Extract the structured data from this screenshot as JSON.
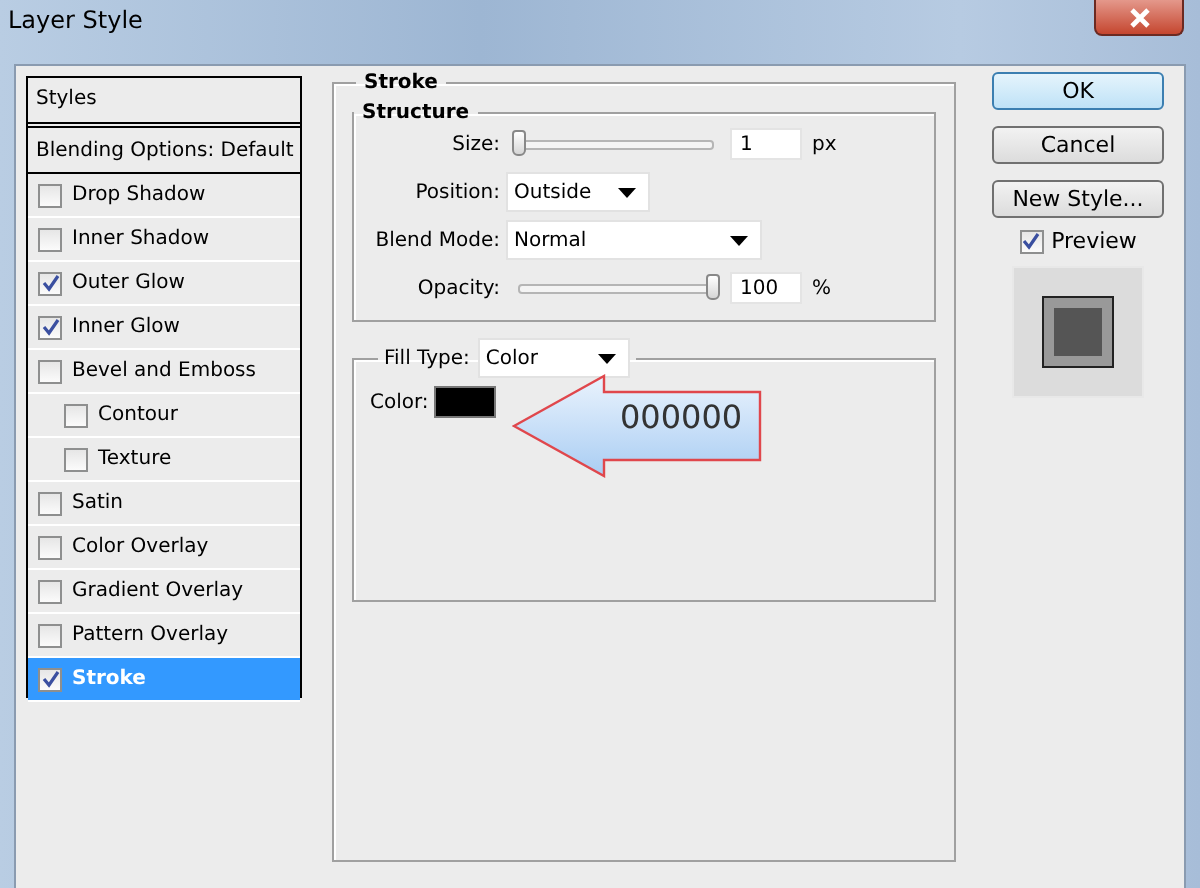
{
  "window": {
    "title": "Layer Style"
  },
  "styles_panel": {
    "header": "Styles",
    "blending_options": "Blending Options: Default",
    "items": [
      {
        "label": "Drop Shadow",
        "checked": false,
        "selected": false
      },
      {
        "label": "Inner Shadow",
        "checked": false,
        "selected": false
      },
      {
        "label": "Outer Glow",
        "checked": true,
        "selected": false
      },
      {
        "label": "Inner Glow",
        "checked": true,
        "selected": false
      },
      {
        "label": "Bevel and Emboss",
        "checked": false,
        "selected": false,
        "children": [
          {
            "label": "Contour",
            "checked": false,
            "selected": false
          },
          {
            "label": "Texture",
            "checked": false,
            "selected": false
          }
        ]
      },
      {
        "label": "Satin",
        "checked": false,
        "selected": false
      },
      {
        "label": "Color Overlay",
        "checked": false,
        "selected": false
      },
      {
        "label": "Gradient Overlay",
        "checked": false,
        "selected": false
      },
      {
        "label": "Pattern Overlay",
        "checked": false,
        "selected": false
      },
      {
        "label": "Stroke",
        "checked": true,
        "selected": true
      }
    ]
  },
  "stroke": {
    "title": "Stroke",
    "structure": {
      "title": "Structure",
      "size": {
        "label": "Size:",
        "level": 0,
        "value": "1",
        "unit": "px"
      },
      "position": {
        "label": "Position:",
        "value": "Outside"
      },
      "blend_mode": {
        "label": "Blend Mode:",
        "value": "Normal"
      },
      "opacity": {
        "label": "Opacity:",
        "level": 1,
        "value": "100",
        "unit": "%"
      }
    },
    "fill_type": {
      "label": "Fill Type:",
      "value": "Color"
    },
    "color": {
      "label": "Color:",
      "color": "#000000"
    }
  },
  "callout": {
    "text": "000000"
  },
  "buttons": [
    {
      "label": "OK",
      "default": true
    },
    {
      "label": "Cancel",
      "default": false
    },
    {
      "label": "New Style...",
      "default": false
    }
  ],
  "preview": {
    "label": "Preview",
    "checked": true
  }
}
